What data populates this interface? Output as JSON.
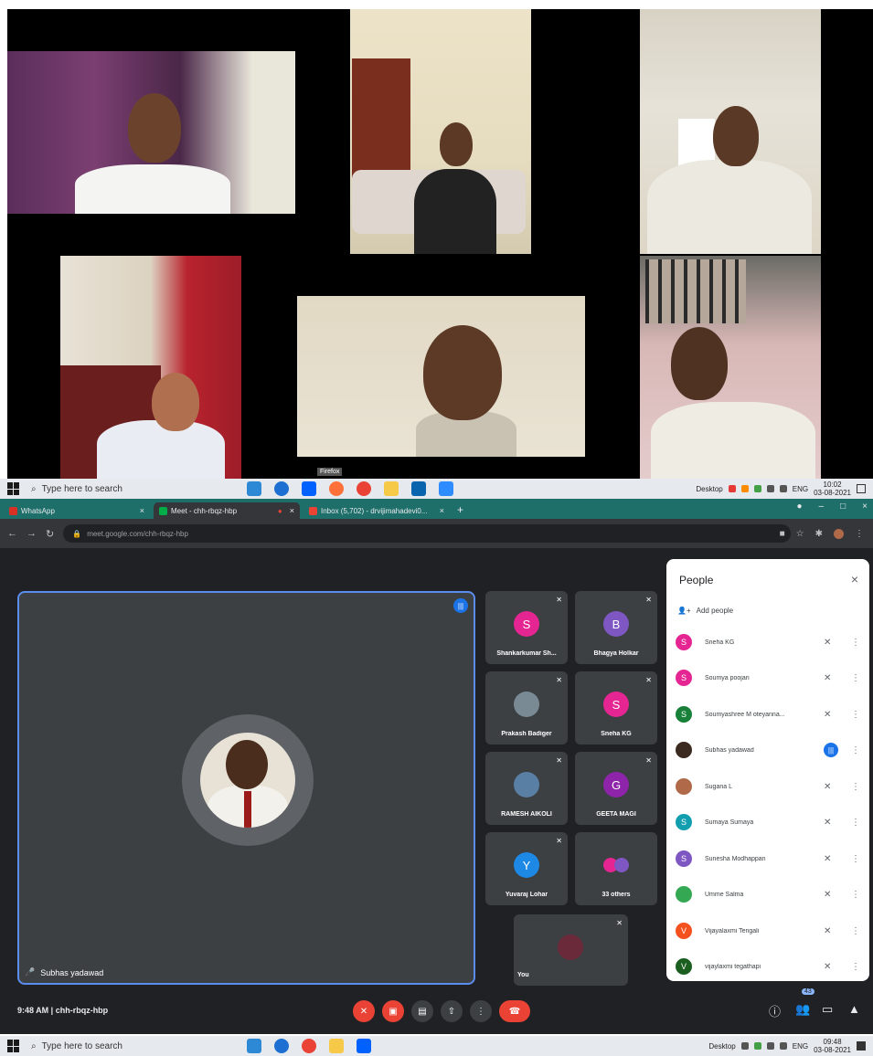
{
  "gallery": {
    "tooltip": "Firefox"
  },
  "taskbar_top": {
    "search_placeholder": "Type here to search",
    "desktop_label": "Desktop",
    "lang": "ENG",
    "time": "10:02",
    "date": "03-08-2021"
  },
  "taskbar_bottom": {
    "search_placeholder": "Type here to search",
    "desktop_label": "Desktop",
    "lang": "ENG",
    "time": "09:48",
    "date": "03-08-2021"
  },
  "browser": {
    "tabs": [
      {
        "label": "WhatsApp",
        "color": "#d93025"
      },
      {
        "label": "Meet - chh-rbqz-hbp",
        "color": "#00ac47"
      },
      {
        "label": "Inbox (5,702) - drvijimahadevi0...",
        "color": "#ea4335"
      }
    ],
    "new_tab": "+",
    "url": "meet.google.com/chh-rbqz-hbp"
  },
  "meet": {
    "main_speaker": "Subhas yadawad",
    "tiles": [
      {
        "name": "Shankarkumar Sh...",
        "initial": "S",
        "color": "#e52592"
      },
      {
        "name": "Bhagya Holkar",
        "initial": "B",
        "color": "#7e57c2"
      },
      {
        "name": "Prakash Badiger",
        "initial": "",
        "color": "#7a8a95"
      },
      {
        "name": "Sneha KG",
        "initial": "S",
        "color": "#e52592"
      },
      {
        "name": "RAMESH AIKOLI",
        "initial": "",
        "color": "#5a7fa4"
      },
      {
        "name": "GEETA MAGI",
        "initial": "G",
        "color": "#8e24aa"
      },
      {
        "name": "Yuvaraj Lohar",
        "initial": "Y",
        "color": "#1e88e5"
      },
      {
        "name": "33 others",
        "initial": "",
        "color": "#e52592"
      },
      {
        "name": "You",
        "initial": "",
        "color": "#6a2a3a"
      }
    ],
    "people_panel": {
      "title": "People",
      "add_people": "Add people",
      "participants": [
        {
          "name": "Sneha KG",
          "initial": "S",
          "color": "#e52592"
        },
        {
          "name": "Soumya poojari",
          "initial": "S",
          "color": "#e52592"
        },
        {
          "name": "Soumyashree M oteyanna...",
          "initial": "S",
          "color": "#188038"
        },
        {
          "name": "Subhas yadawad",
          "initial": "",
          "color": "#3a2a20"
        },
        {
          "name": "Sugana L",
          "initial": "",
          "color": "#b06a4a"
        },
        {
          "name": "Sumaya Sumaya",
          "initial": "S",
          "color": "#129eaf"
        },
        {
          "name": "Sunesha Modhappan",
          "initial": "S",
          "color": "#7e57c2"
        },
        {
          "name": "Umme Salma",
          "initial": "",
          "color": "#34a853"
        },
        {
          "name": "Vijayalaxmi Tengali",
          "initial": "V",
          "color": "#f4511e"
        },
        {
          "name": "vijaylaxmi tegathapi",
          "initial": "V",
          "color": "#1b5e20"
        }
      ]
    },
    "bottom": {
      "time_code": "9:48 AM | chh-rbqz-hbp",
      "people_count": "43"
    }
  }
}
